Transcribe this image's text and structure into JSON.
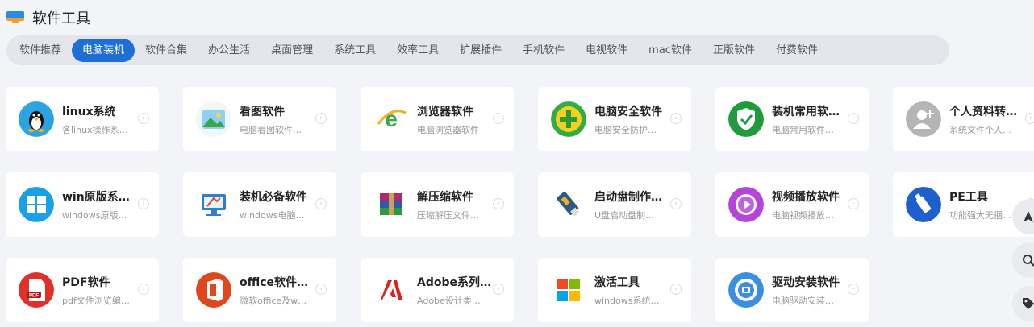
{
  "header": {
    "title": "软件工具"
  },
  "tabs": [
    {
      "label": "软件推荐"
    },
    {
      "label": "电脑装机",
      "active": true
    },
    {
      "label": "软件合集"
    },
    {
      "label": "办公生活"
    },
    {
      "label": "桌面管理"
    },
    {
      "label": "系统工具"
    },
    {
      "label": "效率工具"
    },
    {
      "label": "扩展插件"
    },
    {
      "label": "手机软件"
    },
    {
      "label": "电视软件"
    },
    {
      "label": "mac软件"
    },
    {
      "label": "正版软件"
    },
    {
      "label": "付费软件"
    }
  ],
  "cards": [
    {
      "title": "linux系统",
      "desc": "各linux操作系…",
      "icon": "linux-penguin-icon",
      "color": "#2ba4e0"
    },
    {
      "title": "看图软件",
      "desc": "电脑看图软件…",
      "icon": "image-viewer-icon",
      "color": "#4aa8e8"
    },
    {
      "title": "浏览器软件",
      "desc": "电脑浏览器软件",
      "icon": "browser-e-icon",
      "color": "#3aa84a"
    },
    {
      "title": "电脑安全软件",
      "desc": "电脑安全防护…",
      "icon": "security-plus-icon",
      "color": "#3ab24a"
    },
    {
      "title": "装机常用软…",
      "desc": "电脑常用软件…",
      "icon": "shield-check-icon",
      "color": "#1f9a3c"
    },
    {
      "title": "个人资料转…",
      "desc": "系统文件个人…",
      "icon": "user-add-icon",
      "color": "#b5b5b5"
    },
    {
      "title": "win原版系…",
      "desc": "windows原版…",
      "icon": "windows-logo-icon",
      "color": "#1aa0e8"
    },
    {
      "title": "装机必备软件",
      "desc": "windows电脑…",
      "icon": "monitor-tools-icon",
      "color": "#2f7fd0"
    },
    {
      "title": "解压缩软件",
      "desc": "压缩解压文件…",
      "icon": "archive-books-icon",
      "color": "#8a2b7a"
    },
    {
      "title": "启动盘制作…",
      "desc": "U盘启动盘制…",
      "icon": "usb-drive-icon",
      "color": "#2a5a8a"
    },
    {
      "title": "视频播放软件",
      "desc": "电脑视频播放…",
      "icon": "play-circle-icon",
      "color": "#b545d8"
    },
    {
      "title": "PE工具",
      "desc": "功能强大无捆…",
      "icon": "usb-stick-icon",
      "color": "#1e5fd0"
    },
    {
      "title": "PDF软件",
      "desc": "pdf文件浏览编…",
      "icon": "pdf-file-icon",
      "color": "#e0302a"
    },
    {
      "title": "office软件…",
      "desc": "微软office及w…",
      "icon": "office-logo-icon",
      "color": "#e0481c"
    },
    {
      "title": "Adobe系列…",
      "desc": "Adobe设计类…",
      "icon": "adobe-logo-icon",
      "color": "#e02020"
    },
    {
      "title": "激活工具",
      "desc": "windows系统…",
      "icon": "windows-color-logo-icon",
      "color": "#ffffff"
    },
    {
      "title": "驱动安装软件",
      "desc": "电脑驱动安装…",
      "icon": "driver-gear-icon",
      "color": "#3a8fe0"
    }
  ],
  "side_buttons": [
    {
      "icon": "navigate-arrow-icon"
    },
    {
      "icon": "search-icon"
    },
    {
      "icon": "tag-icon"
    }
  ]
}
